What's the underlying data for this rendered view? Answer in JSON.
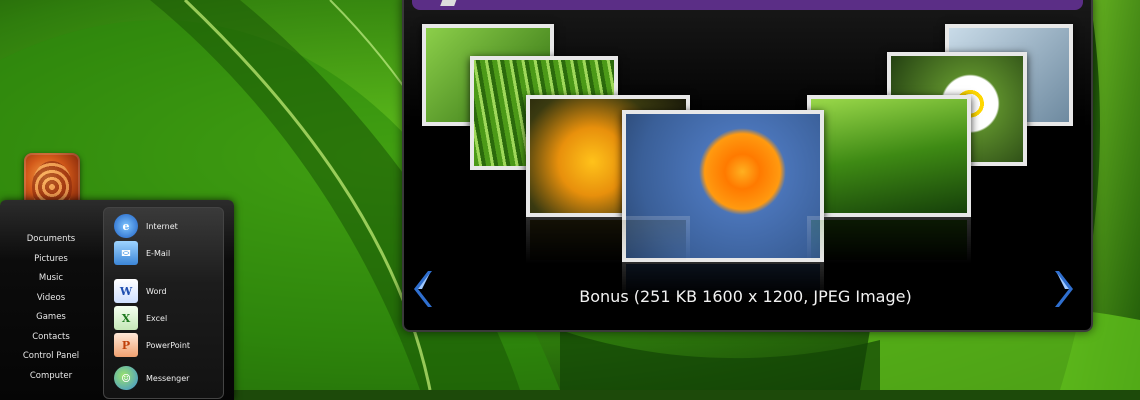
{
  "start_menu": {
    "places": [
      "Documents",
      "Pictures",
      "Music",
      "Videos",
      "Games",
      "Contacts",
      "Control Panel",
      "Computer"
    ],
    "programs": [
      {
        "label": "Internet",
        "icon": "internet-explorer-icon"
      },
      {
        "label": "E-Mail",
        "icon": "email-icon"
      },
      {
        "label": "Word",
        "icon": "word-icon"
      },
      {
        "label": "Excel",
        "icon": "excel-icon"
      },
      {
        "label": "PowerPoint",
        "icon": "powerpoint-icon"
      },
      {
        "label": "Messenger",
        "icon": "messenger-icon"
      }
    ]
  },
  "viewer": {
    "caption": "Bonus  (251 KB 1600 x 1200, JPEG Image)",
    "prev_icon": "chevron-left-icon",
    "next_icon": "chevron-right-icon"
  },
  "colors": {
    "title_bar": "#5b2e86",
    "nav_arrow": "#2f6fcf",
    "wallpaper_green": "#3f9a12"
  }
}
